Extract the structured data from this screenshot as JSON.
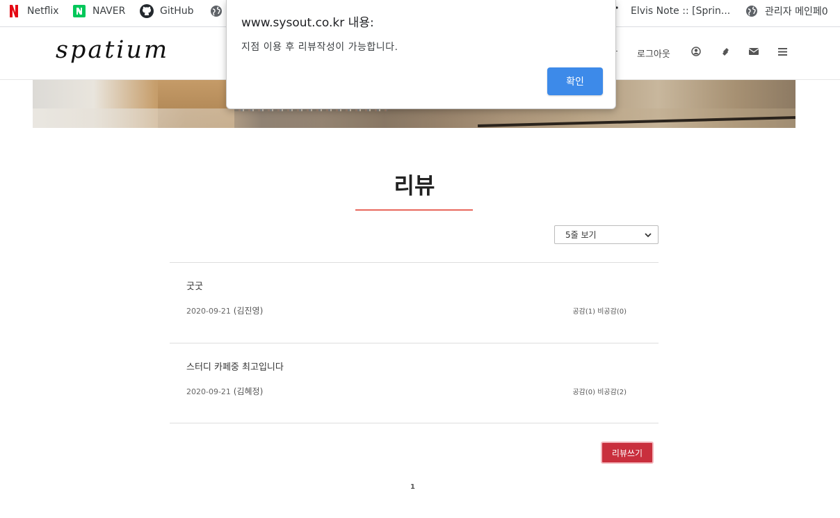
{
  "bookmarks": {
    "netflix": "Netflix",
    "naver": "NAVER",
    "github": "GitHub",
    "elvis": "Elvis Note :: [Sprin...",
    "admin": "관리자 메인페0"
  },
  "header": {
    "logo": "spatium",
    "logout": "로그아웃",
    "icons": [
      "user-circle-icon",
      "ticket-icon",
      "envelope-icon",
      "menu-icon"
    ]
  },
  "page": {
    "title": "리뷰",
    "rows_select": "5줄 보기",
    "write_button": "리뷰쓰기",
    "page_number": "1"
  },
  "reviews": [
    {
      "title": "굿굿",
      "date": "2020-09-21",
      "author": "(김진영)",
      "votes": "공감(1) 비공감(0)"
    },
    {
      "title": "스터디 카페중 최고입니다",
      "date": "2020-09-21",
      "author": "(김혜정)",
      "votes": "공감(0) 비공감(2)"
    }
  ],
  "dialog": {
    "origin": "www.sysout.co.kr 내용:",
    "message": "지점 이용 후 리뷰작성이 가능합니다.",
    "ok": "확인"
  },
  "colors": {
    "accent_underline": "#e8675c",
    "write_button": "#c92f3d",
    "dialog_button": "#3d8ae9"
  }
}
